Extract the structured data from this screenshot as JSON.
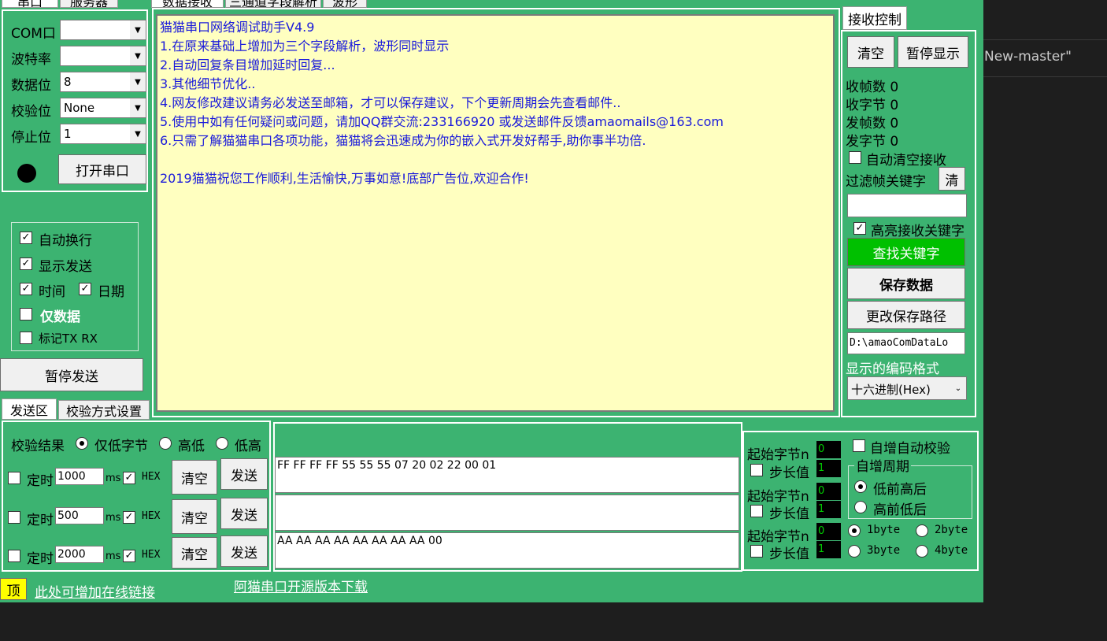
{
  "top_tabs": {
    "serial": "串口",
    "server": "服务器"
  },
  "recv_tabs": {
    "data": "数据接收",
    "parse": "三通道字段解析",
    "wave": "波形"
  },
  "serial": {
    "com_label": "COM口",
    "com_value": "",
    "baud_label": "波特率",
    "baud_value": "",
    "data_label": "数据位",
    "data_value": "8",
    "parity_label": "校验位",
    "parity_value": "None",
    "stop_label": "停止位",
    "stop_value": "1",
    "open_button": "打开串口"
  },
  "options": {
    "auto_wrap": "自动换行",
    "show_send": "显示发送",
    "time": "时间",
    "date": "日期",
    "data_only": "仅数据",
    "mark_txrx": "标记TX RX",
    "pause_send": "暂停发送"
  },
  "bottom_tabs": {
    "send": "发送区",
    "checksum": "校验方式设置"
  },
  "receive_lines": [
    "猫猫串口网络调试助手V4.9",
    "1.在原来基础上增加为三个字段解析，波形同时显示",
    "2.自动回复条目增加延时回复...",
    "3.其他细节优化..",
    "4.网友修改建议请务必发送至邮箱，才可以保存建议，下个更新周期会先查看邮件..",
    "5.使用中如有任何疑问或问题，请加QQ群交流:233166920 或发送邮件反馈amaomails@163.com",
    "6.只需了解猫猫串口各项功能，猫猫将会迅速成为你的嵌入式开发好帮手,助你事半功倍.",
    "",
    "2019猫猫祝您工作顺利,生活愉快,万事如意!底部广告位,欢迎合作!"
  ],
  "recv_control": {
    "title": "接收控制",
    "clear": "清空",
    "pause_display": "暂停显示",
    "rx_frames": "收帧数 0",
    "rx_bytes": "收字节 0",
    "tx_frames": "发帧数 0",
    "tx_bytes": "发字节 0",
    "auto_clear": "自动清空接收",
    "filter_label": "过滤帧关键字",
    "filter_clear": "清",
    "filter_value": "",
    "highlight": "高亮接收关键字",
    "find_keyword": "查找关键字",
    "save_data": "保存数据",
    "change_path": "更改保存路径",
    "path": "D:\\amaoComDataLo",
    "encoding_label": "显示的编码格式",
    "encoding_value": "十六进制(Hex)"
  },
  "checksum": {
    "result_label": "校验结果",
    "low_only": "仅低字节",
    "high_low": "高低",
    "low_high": "低高"
  },
  "send_rows": [
    {
      "timer_label": "定时",
      "interval": "1000",
      "unit": "ms",
      "hex": "HEX",
      "clear": "清空",
      "send": "发送",
      "content": "FF FF FF FF 55 55 55 07 20 02 22 00 01"
    },
    {
      "timer_label": "定时",
      "interval": "500",
      "unit": "ms",
      "hex": "HEX",
      "clear": "清空",
      "send": "发送",
      "content": ""
    },
    {
      "timer_label": "定时",
      "interval": "2000",
      "unit": "ms",
      "hex": "HEX",
      "clear": "清空",
      "send": "发送",
      "content": "AA AA AA AA AA AA AA AA 00"
    }
  ],
  "auto_inc": {
    "start_label": "起始字节n",
    "step_label": "步长值",
    "rows": [
      {
        "start": "0",
        "step": "1"
      },
      {
        "start": "0",
        "step": "1"
      },
      {
        "start": "0",
        "step": "1"
      }
    ],
    "auto_checksum": "自增自动校验",
    "period_title": "自增周期",
    "low_first": "低前高后",
    "high_first": "高前低后",
    "b1": "1byte",
    "b2": "2byte",
    "b3": "3byte",
    "b4": "4byte"
  },
  "footer": {
    "top_button": "顶",
    "online_link": "此处可增加在线链接",
    "download_link": "阿猫串口开源版本下载"
  },
  "background": {
    "editor_text": "New-master\""
  }
}
